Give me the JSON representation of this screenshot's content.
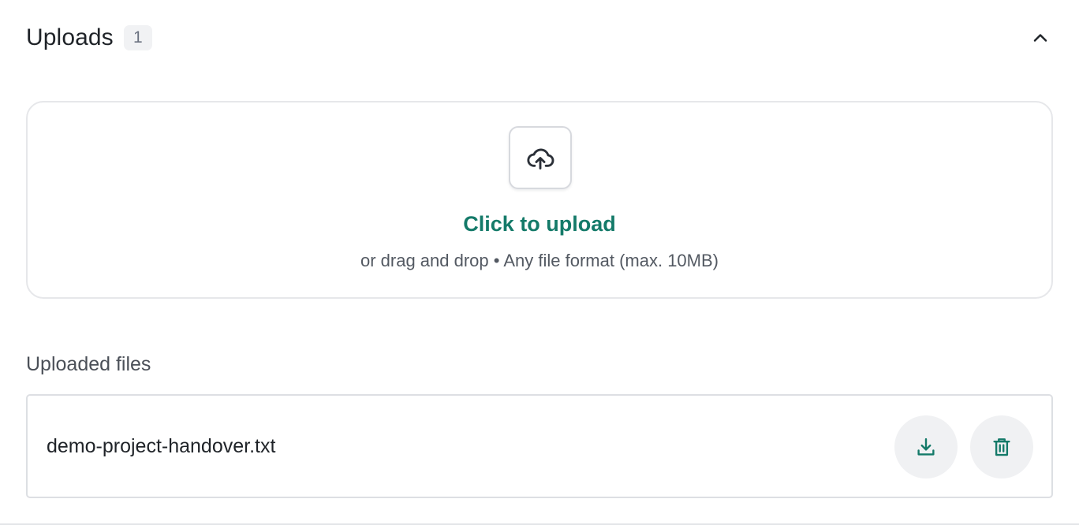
{
  "uploads": {
    "title": "Uploads",
    "count": "1",
    "collapse_icon": "chevron-up-icon"
  },
  "dropzone": {
    "icon": "cloud-upload-icon",
    "action_label": "Click to upload",
    "hint": "or drag and drop • Any file format (max. 10MB)"
  },
  "uploaded_files": {
    "label": "Uploaded files",
    "items": [
      {
        "name": "demo-project-handover.txt",
        "download_icon": "download-icon",
        "delete_icon": "trash-icon"
      }
    ]
  },
  "colors": {
    "accent": "#147a69",
    "text": "#1f2328",
    "muted": "#535962",
    "border": "#e6e7ea",
    "icon_button_bg": "#f0f1f3"
  }
}
